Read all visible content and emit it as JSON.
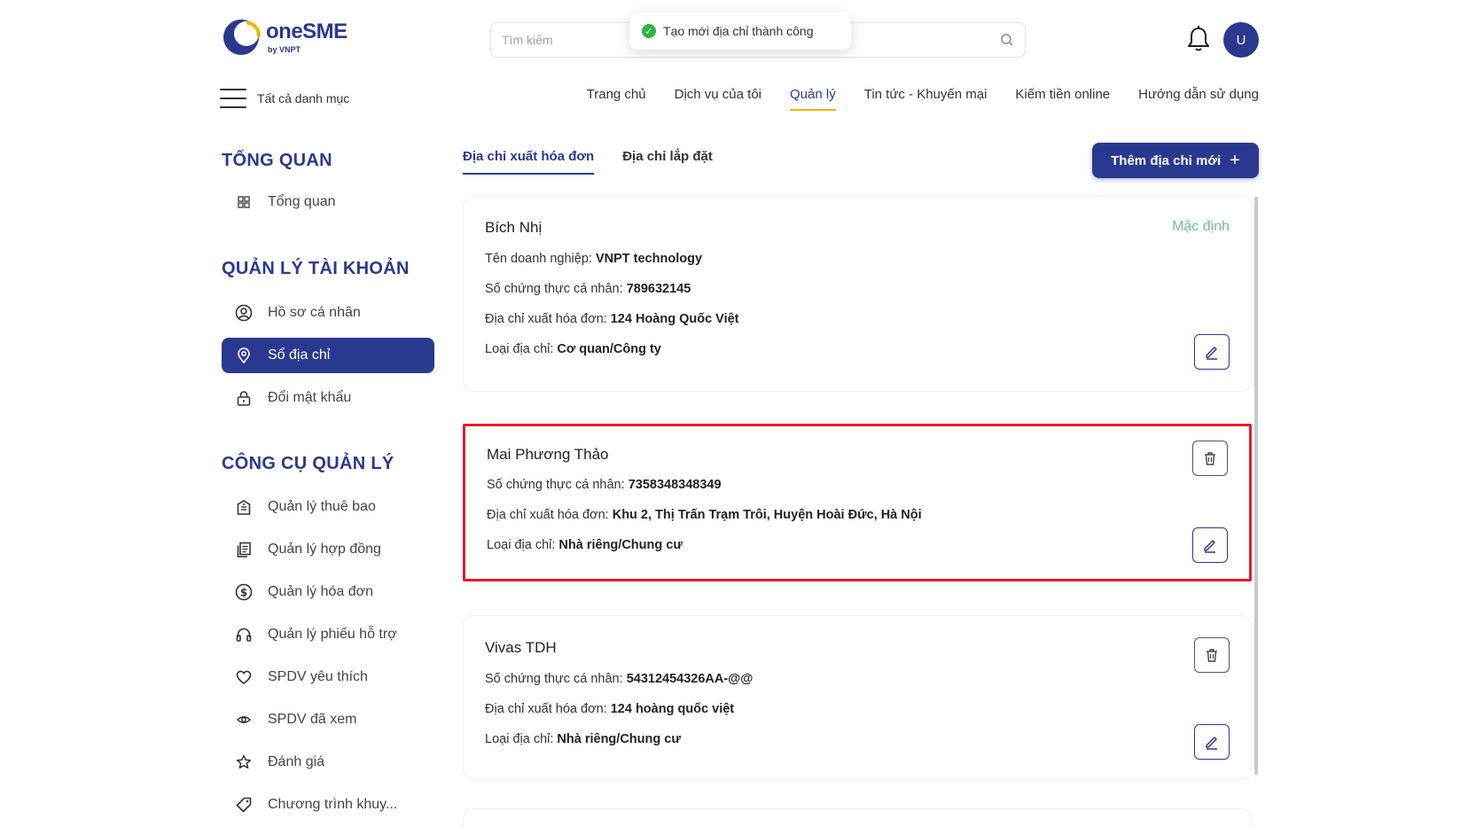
{
  "header": {
    "logo_text": "oneSME",
    "logo_sub": "by VNPT",
    "search_placeholder": "Tìm kiếm",
    "toast_message": "Tạo mới địa chỉ thành công",
    "avatar_initial": "U",
    "all_categories": "Tất cả danh mục",
    "nav": [
      {
        "label": "Trang chủ"
      },
      {
        "label": "Dịch vụ của tôi"
      },
      {
        "label": "Quản lý",
        "active": true
      },
      {
        "label": "Tin tức - Khuyến mại"
      },
      {
        "label": "Kiếm tiền online"
      },
      {
        "label": "Hướng dẫn sử dụng"
      }
    ]
  },
  "sidebar": {
    "overview_title": "TỔNG QUAN",
    "overview_items": [
      "Tổng quan"
    ],
    "account_title": "QUẢN LÝ TÀI KHOẢN",
    "account_items": [
      "Hồ sơ cá nhân",
      "Sổ địa chỉ",
      "Đổi mật khẩu"
    ],
    "active_item": "Sổ địa chỉ",
    "tools_title": "CÔNG CỤ QUẢN LÝ",
    "tools_items": [
      "Quản lý thuê bao",
      "Quản lý hợp đồng",
      "Quản lý hóa đơn",
      "Quản lý phiếu hỗ trợ",
      "SPDV yêu thích",
      "SPDV đã xem",
      "Đánh giá",
      "Chương trình khuy..."
    ]
  },
  "tabs": [
    {
      "label": "Địa chỉ xuất hóa đơn",
      "active": true
    },
    {
      "label": "Địa chỉ lắp đặt"
    }
  ],
  "add_button": "Thêm địa chỉ mới",
  "addresses": [
    {
      "name": "Bích Nhị",
      "default_label": "Mặc định",
      "company_label": "Tên doanh nghiệp:",
      "company": "VNPT technology",
      "id_label": "Số chứng thực cá nhân:",
      "id": "789632145",
      "addr_label": "Địa chỉ xuất hóa đơn:",
      "addr": "124 Hoàng Quốc Việt",
      "type_label": "Loại địa chỉ:",
      "type": "Cơ quan/Công ty"
    },
    {
      "name": "Mai Phương Thảo",
      "id_label": "Số chứng thực cá nhân:",
      "id": "7358348348349",
      "addr_label": "Địa chỉ xuất hóa đơn:",
      "addr": "Khu 2, Thị Trấn Trạm Trôi, Huyện Hoài Đức, Hà Nội",
      "type_label": "Loại địa chỉ:",
      "type": "Nhà riêng/Chung cư"
    },
    {
      "name": "Vivas TDH",
      "id_label": "Số chứng thực cá nhân:",
      "id": "54312454326AA-@@",
      "addr_label": "Địa chỉ xuất hóa đơn:",
      "addr": "124 hoàng quốc việt",
      "type_label": "Loại địa chỉ:",
      "type": "Nhà riêng/Chung cư"
    }
  ]
}
